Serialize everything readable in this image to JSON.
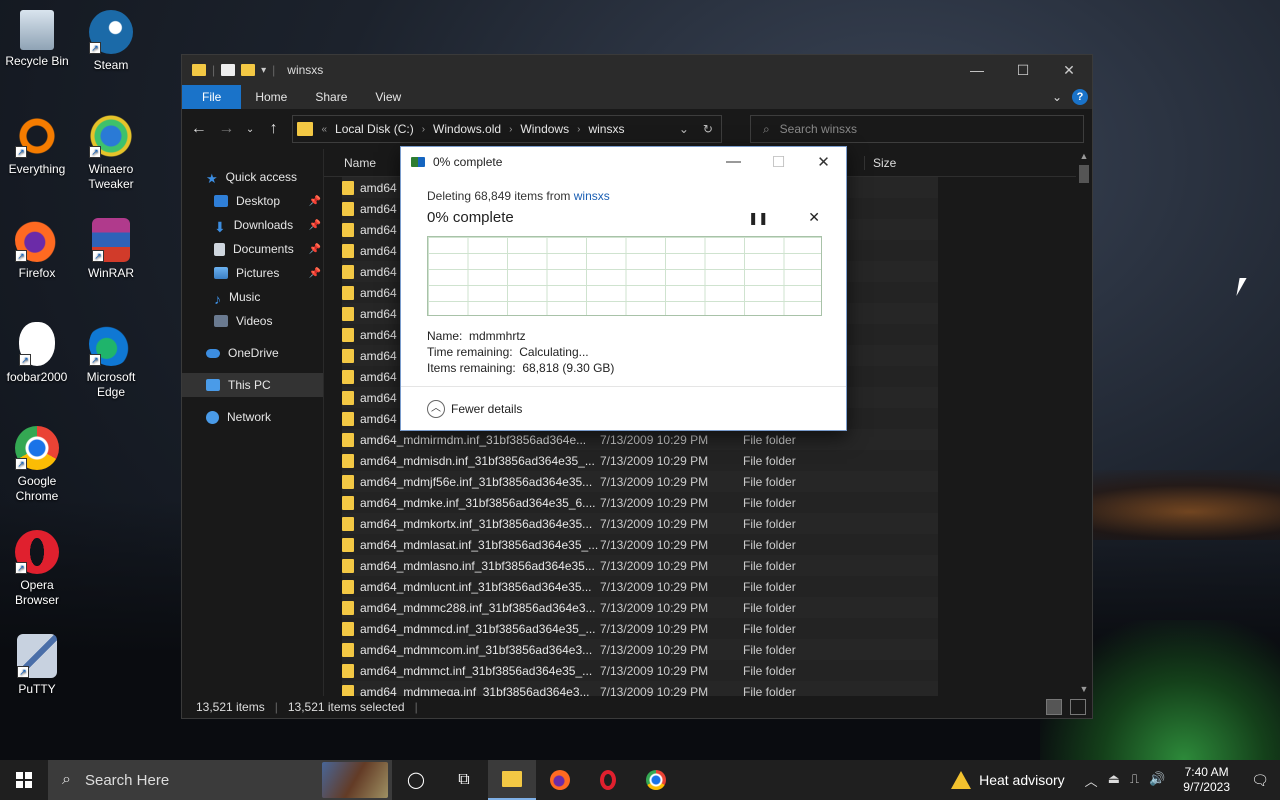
{
  "desktop_icons": [
    {
      "label": "Recycle Bin",
      "icon": "recycle-bin-icon"
    },
    {
      "label": "Steam",
      "icon": "steam-icon"
    },
    {
      "label": "Everything",
      "icon": "everything-icon"
    },
    {
      "label": "Winaero Tweaker",
      "icon": "winaero-icon"
    },
    {
      "label": "Firefox",
      "icon": "firefox-icon"
    },
    {
      "label": "WinRAR",
      "icon": "winrar-icon"
    },
    {
      "label": "foobar2000",
      "icon": "foobar-icon"
    },
    {
      "label": "Microsoft Edge",
      "icon": "edge-icon"
    },
    {
      "label": "Google Chrome",
      "icon": "chrome-icon"
    },
    {
      "label": "Opera Browser",
      "icon": "opera-icon"
    },
    {
      "label": "PuTTY",
      "icon": "putty-icon"
    }
  ],
  "explorer": {
    "title": "winsxs",
    "ribbon": {
      "file": "File",
      "home": "Home",
      "share": "Share",
      "view": "View"
    },
    "path": {
      "root": "Local Disk (C:)",
      "p1": "Windows.old",
      "p2": "Windows",
      "p3": "winsxs"
    },
    "search_placeholder": "Search winsxs",
    "nav": {
      "quick_access": "Quick access",
      "desktop": "Desktop",
      "downloads": "Downloads",
      "documents": "Documents",
      "pictures": "Pictures",
      "music": "Music",
      "videos": "Videos",
      "onedrive": "OneDrive",
      "thispc": "This PC",
      "network": "Network"
    },
    "columns": {
      "name": "Name",
      "size": "Size"
    },
    "hidden_rows": [
      "amd64",
      "amd64",
      "amd64",
      "amd64",
      "amd64",
      "amd64",
      "amd64",
      "amd64",
      "amd64",
      "amd64",
      "amd64",
      "amd64"
    ],
    "rows": [
      {
        "name": "amd64_mdmirmdm.inf_31bf3856ad364e...",
        "date": "7/13/2009 10:29 PM",
        "type": "File folder"
      },
      {
        "name": "amd64_mdmisdn.inf_31bf3856ad364e35_...",
        "date": "7/13/2009 10:29 PM",
        "type": "File folder"
      },
      {
        "name": "amd64_mdmjf56e.inf_31bf3856ad364e35...",
        "date": "7/13/2009 10:29 PM",
        "type": "File folder"
      },
      {
        "name": "amd64_mdmke.inf_31bf3856ad364e35_6....",
        "date": "7/13/2009 10:29 PM",
        "type": "File folder"
      },
      {
        "name": "amd64_mdmkortx.inf_31bf3856ad364e35...",
        "date": "7/13/2009 10:29 PM",
        "type": "File folder"
      },
      {
        "name": "amd64_mdmlasat.inf_31bf3856ad364e35_...",
        "date": "7/13/2009 10:29 PM",
        "type": "File folder"
      },
      {
        "name": "amd64_mdmlasno.inf_31bf3856ad364e35...",
        "date": "7/13/2009 10:29 PM",
        "type": "File folder"
      },
      {
        "name": "amd64_mdmlucnt.inf_31bf3856ad364e35...",
        "date": "7/13/2009 10:29 PM",
        "type": "File folder"
      },
      {
        "name": "amd64_mdmmc288.inf_31bf3856ad364e3...",
        "date": "7/13/2009 10:29 PM",
        "type": "File folder"
      },
      {
        "name": "amd64_mdmmcd.inf_31bf3856ad364e35_...",
        "date": "7/13/2009 10:29 PM",
        "type": "File folder"
      },
      {
        "name": "amd64_mdmmcom.inf_31bf3856ad364e3...",
        "date": "7/13/2009 10:29 PM",
        "type": "File folder"
      },
      {
        "name": "amd64_mdmmct.inf_31bf3856ad364e35_...",
        "date": "7/13/2009 10:29 PM",
        "type": "File folder"
      },
      {
        "name": "amd64_mdmmega.inf_31bf3856ad364e3...",
        "date": "7/13/2009 10:29 PM",
        "type": "File folder"
      }
    ],
    "status": {
      "items": "13,521 items",
      "selected": "13,521 items selected"
    }
  },
  "dialog": {
    "title": "0% complete",
    "deleting_prefix": "Deleting 68,849 items from",
    "deleting_link": "winsxs",
    "headline": "0% complete",
    "progress": 0,
    "name_label": "Name:",
    "name_value": "mdmmhrtz",
    "time_label": "Time remaining:",
    "time_value": "Calculating...",
    "items_label": "Items remaining:",
    "items_value": "68,818 (9.30 GB)",
    "fewer_details": "Fewer details"
  },
  "taskbar": {
    "search_placeholder": "Search Here",
    "weather": "Heat advisory",
    "time": "7:40 AM",
    "date": "9/7/2023"
  },
  "colors": {
    "accent": "#1a73c9",
    "folder": "#f3c844",
    "link": "#1a5fb4"
  }
}
